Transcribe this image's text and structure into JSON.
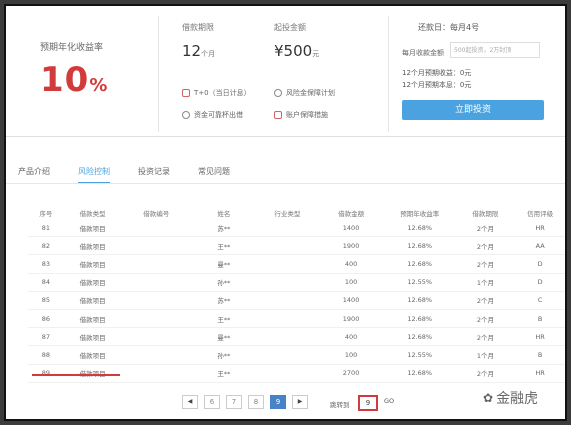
{
  "summary": {
    "rate_label": "预期年化收益率",
    "rate_number": "10",
    "rate_unit": "%",
    "term_label": "借款期限",
    "term_number": "12",
    "term_unit": "个月",
    "min_label": "起投金额",
    "min_number": "¥500",
    "min_unit": "元",
    "features": [
      "T+0（当日计息）",
      "风险金保障计划",
      "资金可靠杯出借",
      "账户保障措施"
    ]
  },
  "invest": {
    "pay_day": "还款日：每月4号",
    "amount_label": "每月收款金额",
    "amount_placeholder": "500起投资，2万封顶",
    "expected_income": "12个月预期收益：0元",
    "expected_total": "12个月预期本息：0元",
    "button": "立即投资"
  },
  "tabs": [
    "产品介绍",
    "风险控制",
    "投资记录",
    "常见问题"
  ],
  "table": {
    "headers": [
      "序号",
      "借款类型",
      "借款编号",
      "姓名",
      "行业类型",
      "借款金额",
      "预期年收益率",
      "借款期限",
      "信用评级"
    ],
    "rows": [
      [
        "81",
        "借款项目",
        "",
        "苏**",
        "",
        "1400",
        "12.68%",
        "2个月",
        "HR"
      ],
      [
        "82",
        "借款项目",
        "",
        "王**",
        "",
        "1900",
        "12.68%",
        "2个月",
        "AA"
      ],
      [
        "83",
        "借款项目",
        "",
        "曼**",
        "",
        "400",
        "12.68%",
        "2个月",
        "D"
      ],
      [
        "84",
        "借款项目",
        "",
        "孙**",
        "",
        "100",
        "12.55%",
        "1个月",
        "D"
      ],
      [
        "85",
        "借款项目",
        "",
        "苏**",
        "",
        "1400",
        "12.68%",
        "2个月",
        "C"
      ],
      [
        "86",
        "借款项目",
        "",
        "王**",
        "",
        "1900",
        "12.68%",
        "2个月",
        "B"
      ],
      [
        "87",
        "借款项目",
        "",
        "曼**",
        "",
        "400",
        "12.68%",
        "2个月",
        "HR"
      ],
      [
        "88",
        "借款项目",
        "",
        "孙**",
        "",
        "100",
        "12.55%",
        "1个月",
        "B"
      ],
      [
        "89",
        "借款项目",
        "",
        "王**",
        "",
        "2700",
        "12.68%",
        "2个月",
        "HR"
      ]
    ]
  },
  "pagination": {
    "prev": "◀",
    "pages": [
      "6",
      "7",
      "8",
      "9"
    ],
    "next": "▶",
    "goto_label": "跳转到",
    "goto_value": "9",
    "go": "GO"
  },
  "watermark": {
    "icon": "wechat-icon",
    "text": "金融虎"
  },
  "colors": {
    "accent_red": "#d23b3b",
    "accent_blue": "#4aa3e0",
    "page_blue": "#4a82c8"
  }
}
